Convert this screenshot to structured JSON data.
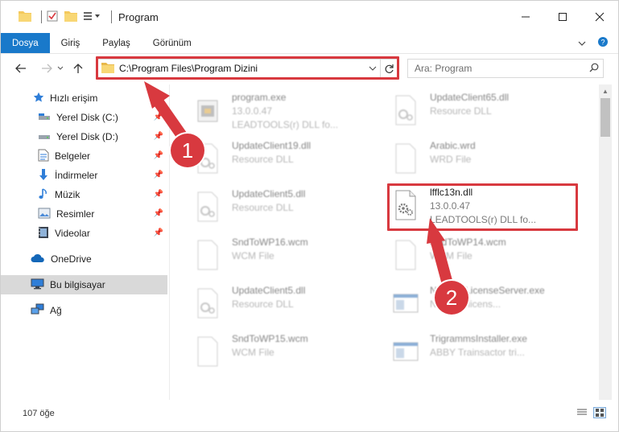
{
  "window": {
    "title": "Program"
  },
  "ribbon": {
    "tabs": [
      "Dosya",
      "Giriş",
      "Paylaş",
      "Görünüm"
    ]
  },
  "address": {
    "path": "C:\\Program Files\\Program Dizini"
  },
  "search": {
    "placeholder": "Ara: Program"
  },
  "sidebar": {
    "items": [
      {
        "label": "Hızlı erişim",
        "icon": "star-icon"
      },
      {
        "label": "Yerel Disk (C:)",
        "icon": "drive-icon",
        "pinned": true
      },
      {
        "label": "Yerel Disk (D:)",
        "icon": "drive-icon",
        "pinned": true
      },
      {
        "label": "Belgeler",
        "icon": "documents-icon",
        "pinned": true
      },
      {
        "label": "İndirmeler",
        "icon": "download-icon",
        "pinned": true
      },
      {
        "label": "Müzik",
        "icon": "music-icon",
        "pinned": true
      },
      {
        "label": "Resimler",
        "icon": "pictures-icon",
        "pinned": true
      },
      {
        "label": "Videolar",
        "icon": "video-icon",
        "pinned": true
      },
      {
        "label": "OneDrive",
        "icon": "cloud-icon"
      },
      {
        "label": "Bu bilgisayar",
        "icon": "computer-icon",
        "selected": true
      },
      {
        "label": "Ağ",
        "icon": "network-icon"
      }
    ]
  },
  "files": [
    {
      "name": "program.exe",
      "meta1": "13.0.0.47",
      "meta2": "LEADTOOLS(r) DLL fo...",
      "icon": "exe-icon"
    },
    {
      "name": "UpdateClient65.dll",
      "meta1": "Resource DLL",
      "meta2": "",
      "icon": "dll-icon"
    },
    {
      "name": "UpdateClient19.dll",
      "meta1": "Resource DLL",
      "meta2": "",
      "icon": "dll-icon"
    },
    {
      "name": "Arabic.wrd",
      "meta1": "WRD File",
      "meta2": "",
      "icon": "blank-file-icon"
    },
    {
      "name": "UpdateClient5.dll",
      "meta1": "Resource DLL",
      "meta2": "",
      "icon": "dll-icon"
    },
    {
      "name": "lfflc13n.dll",
      "meta1": "13.0.0.47",
      "meta2": "LEADTOOLS(r) DLL fo...",
      "icon": "dll-icon"
    },
    {
      "name": "SndToWP16.wcm",
      "meta1": "WCM File",
      "meta2": "",
      "icon": "blank-file-icon"
    },
    {
      "name": "SndToWP14.wcm",
      "meta1": "WCM File",
      "meta2": "",
      "icon": "blank-file-icon"
    },
    {
      "name": "UpdateClient5.dll",
      "meta1": "Resource DLL",
      "meta2": "",
      "icon": "dll-icon"
    },
    {
      "name": "NetworkLicenseServer.exe",
      "meta1": "Network licens...",
      "meta2": "",
      "icon": "app-icon"
    },
    {
      "name": "SndToWP15.wcm",
      "meta1": "WCM File",
      "meta2": "",
      "icon": "blank-file-icon"
    },
    {
      "name": "TrigrammsInstaller.exe",
      "meta1": "ABBY Trainsactor tri...",
      "meta2": "",
      "icon": "app-icon"
    }
  ],
  "status": {
    "count": "107 öğe"
  },
  "annotations": [
    {
      "label": "1"
    },
    {
      "label": "2"
    }
  ],
  "colors": {
    "accent": "#1979ca",
    "highlight": "#d8393f",
    "selected": "#d9d9d9"
  }
}
